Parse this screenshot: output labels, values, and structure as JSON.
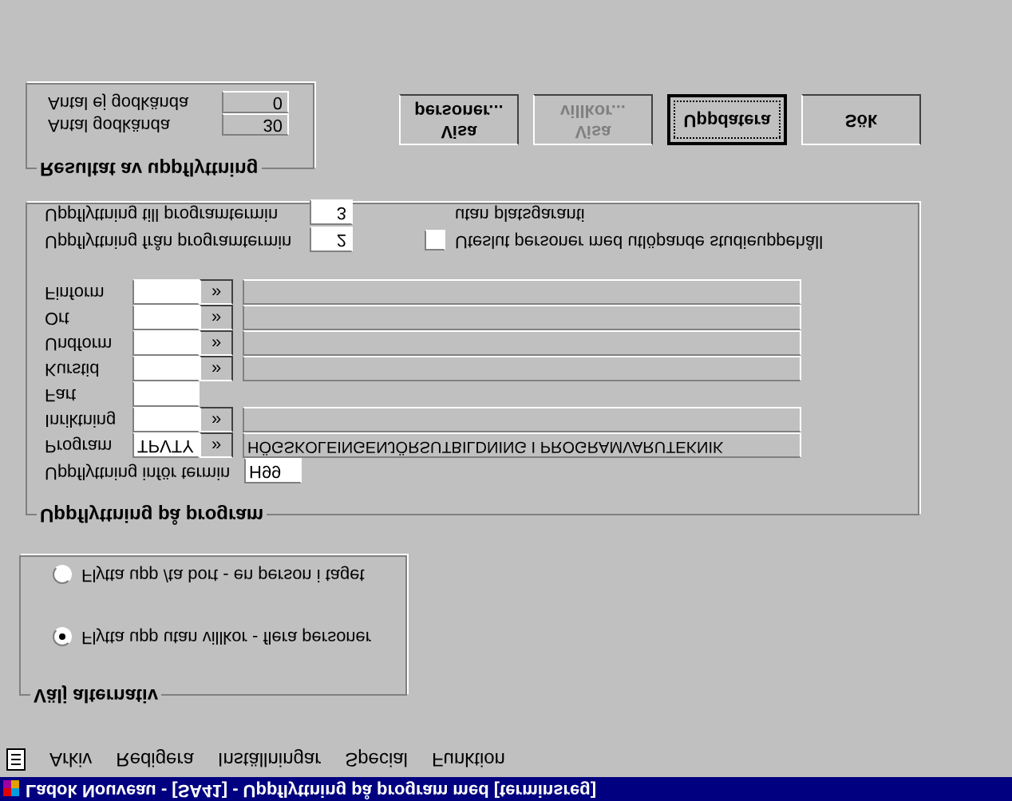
{
  "window": {
    "title": "Ladok  Nouveau - [SA41] - Uppflyttning på program med [terminsreg]"
  },
  "menu": [
    {
      "label": "Arkiv"
    },
    {
      "label": "Redigera"
    },
    {
      "label": "Inställningar"
    },
    {
      "label": "Special"
    },
    {
      "label": "Funktion"
    }
  ],
  "alternatives": {
    "title": "Välj alternativ",
    "options": [
      {
        "label": "Flytta upp /ta bort - en person i taget",
        "selected": false
      },
      {
        "label": "Flytta upp utan villkor - flera personer",
        "selected": true
      }
    ]
  },
  "program_group": {
    "title": "Uppflyttning på program",
    "term": {
      "label": "Uppflyttning inför termin",
      "value": "H99"
    },
    "rows": [
      {
        "label": "Finform",
        "kind": "lookup"
      },
      {
        "label": "Ort",
        "kind": "lookup"
      },
      {
        "label": "Undform",
        "kind": "lookup"
      },
      {
        "label": "Kurstid",
        "kind": "lookup"
      },
      {
        "label": "Fart",
        "kind": "plain"
      },
      {
        "label": "Inriktning",
        "kind": "lookup"
      },
      {
        "label": "Program",
        "kind": "lookup",
        "value": "TPVTY",
        "description": "HÖGSKOLEINGENJÖRSUTBILDNING I PROGRAMVARUTEKNIK"
      }
    ],
    "lookup_symbol": "»",
    "terms": [
      {
        "label": "Uppflyttning till programtermin",
        "value": "3"
      },
      {
        "label": "Uppflyttning från programtermin",
        "value": "2"
      }
    ],
    "exclude": {
      "label": "Uteslut personer med utlöpande studieuppehåll",
      "label_2": "utan platsgaranti",
      "checked": false
    }
  },
  "results": {
    "title": "Resultat av uppflyttning",
    "rows": [
      {
        "label": "Antal ej godkända",
        "value": "0"
      },
      {
        "label": "Antal godkända",
        "value": "30"
      }
    ]
  },
  "buttons": [
    {
      "lines": [
        "personer...",
        "Visa"
      ],
      "disabled": false,
      "focused": false
    },
    {
      "lines": [
        "villkor...",
        "Visa"
      ],
      "disabled": true,
      "focused": false
    },
    {
      "lines": [
        "Uppdatera"
      ],
      "disabled": false,
      "focused": true
    },
    {
      "lines": [
        "Sök"
      ],
      "disabled": false,
      "focused": false
    }
  ]
}
